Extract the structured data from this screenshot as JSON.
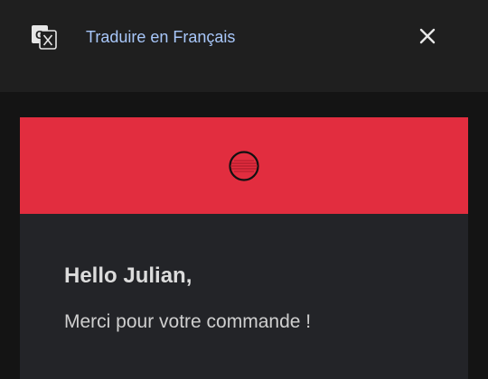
{
  "translation_bar": {
    "icon": "google-translate-icon",
    "label": "Traduire en Français",
    "close_icon": "close-icon"
  },
  "email": {
    "header_color": "#e22d3f",
    "logo_icon": "brand-logo-icon",
    "greeting": "Hello Julian,",
    "body_line": "Merci pour votre commande !",
    "cut_off_line": ""
  },
  "colors": {
    "accent_link": "#a8c7fa",
    "brand_red": "#e22d3f"
  }
}
